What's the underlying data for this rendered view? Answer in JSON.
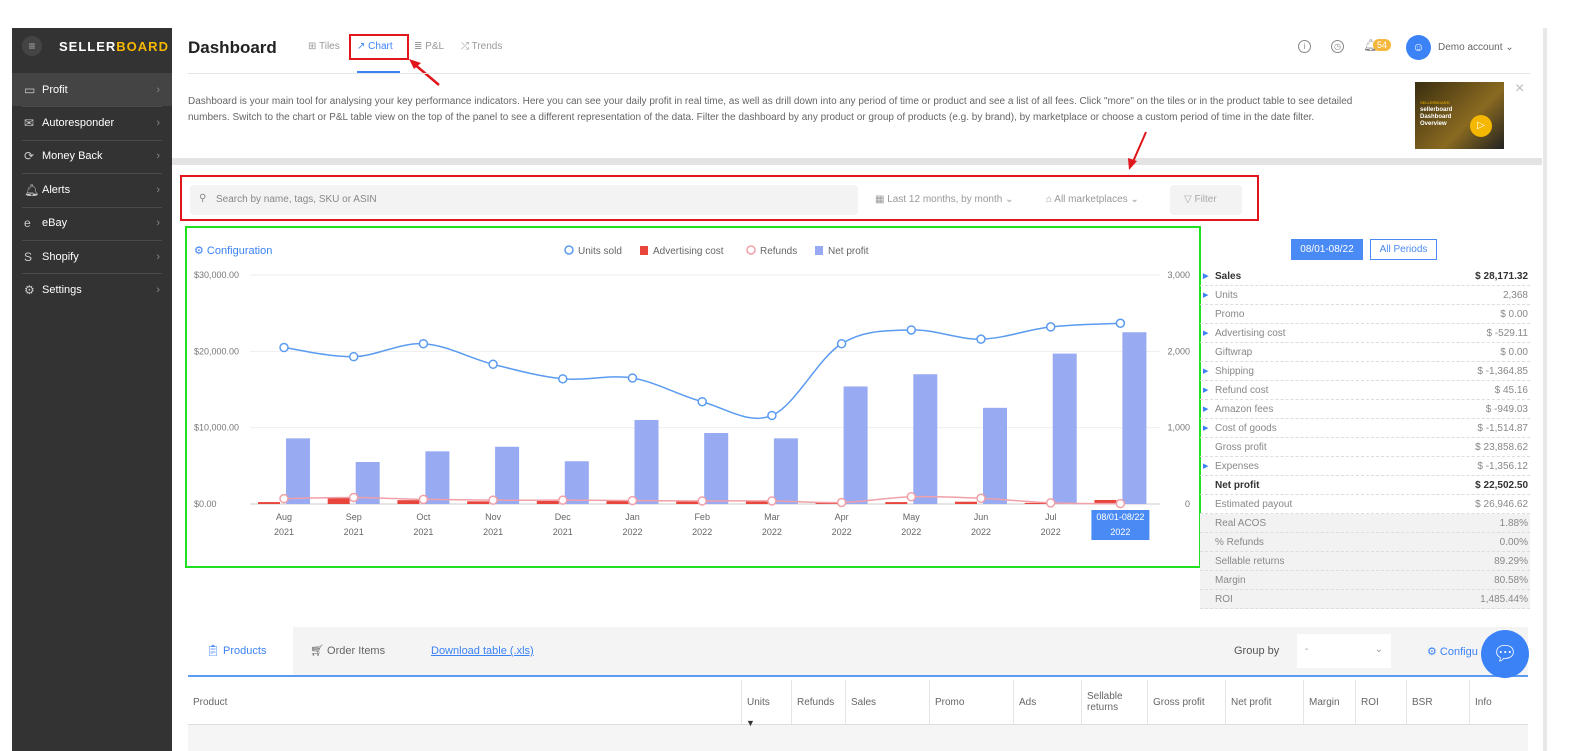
{
  "sidebar": {
    "brand_a": "SELLER",
    "brand_b": "BOARD",
    "items": [
      {
        "label": "Profit",
        "icon": "monitor-icon"
      },
      {
        "label": "Autoresponder",
        "icon": "envelope-icon"
      },
      {
        "label": "Money Back",
        "icon": "refresh-icon"
      },
      {
        "label": "Alerts",
        "icon": "bell-icon"
      },
      {
        "label": "eBay",
        "icon": "ebay-icon"
      },
      {
        "label": "Shopify",
        "icon": "shopify-icon"
      },
      {
        "label": "Settings",
        "icon": "gear-icon"
      }
    ]
  },
  "header": {
    "title": "Dashboard",
    "tabs": [
      "Tiles",
      "Chart",
      "P&L",
      "Trends"
    ],
    "active_tab": "Chart",
    "notifications": "54",
    "account": "Demo account"
  },
  "description": "Dashboard is your main tool for analysing your key performance indicators. Here you can see your daily profit in real time, as well as drill down into any period of time or product and see a list of all fees. Click \"more\" on the tiles or in the product table to see detailed numbers. Switch to the chart or P&L table view on the top of the panel to see a different representation of the data. Filter the dashboard by any product or group of products (e.g. by brand), by marketplace or choose a custom period of time in the date filter.",
  "video": {
    "brand": "SELLERBOARD",
    "title": "sellerboard Dashboard Overview"
  },
  "filters": {
    "search_placeholder": "Search by name, tags, SKU or ASIN",
    "period": "Last 12 months, by month",
    "marketplace": "All marketplaces",
    "filter": "Filter"
  },
  "chart_config_label": "Configuration",
  "colors": {
    "accent": "#3b82f6",
    "units": "#5b9bf0",
    "ads": "#e8453c",
    "refunds": "#f0a0a8",
    "net_profit": "#97aaf2"
  },
  "chart_data": {
    "type": "bar",
    "categories": [
      [
        "Aug",
        "2021"
      ],
      [
        "Sep",
        "2021"
      ],
      [
        "Oct",
        "2021"
      ],
      [
        "Nov",
        "2021"
      ],
      [
        "Dec",
        "2021"
      ],
      [
        "Jan",
        "2022"
      ],
      [
        "Feb",
        "2022"
      ],
      [
        "Mar",
        "2022"
      ],
      [
        "Apr",
        "2022"
      ],
      [
        "May",
        "2022"
      ],
      [
        "Jun",
        "2022"
      ],
      [
        "Jul",
        "2022"
      ],
      [
        "08/01-08/22",
        "2022"
      ]
    ],
    "y_left": {
      "ticks": [
        "$0.00",
        "$10,000.00",
        "$20,000.00",
        "$30,000.00"
      ],
      "range": [
        0,
        30000
      ]
    },
    "y_right": {
      "ticks": [
        "0",
        "1,000",
        "2,000",
        "3,000"
      ],
      "range": [
        0,
        3000
      ]
    },
    "legend": [
      "Units sold",
      "Advertising cost",
      "Refunds",
      "Net profit"
    ],
    "legend_position": "top",
    "grid": true,
    "series": [
      {
        "name": "Units sold",
        "type": "line",
        "axis": "right",
        "values": [
          2050,
          1930,
          2100,
          1830,
          1640,
          1650,
          1340,
          1160,
          2100,
          2280,
          2160,
          2320,
          2368
        ]
      },
      {
        "name": "Advertising cost",
        "type": "bar",
        "axis": "left",
        "values": [
          250,
          800,
          500,
          350,
          400,
          400,
          450,
          450,
          250,
          250,
          300,
          150,
          529
        ]
      },
      {
        "name": "Refunds",
        "type": "line",
        "axis": "right",
        "values": [
          70,
          85,
          60,
          50,
          50,
          45,
          40,
          40,
          20,
          95,
          75,
          15,
          5
        ]
      },
      {
        "name": "Net profit",
        "type": "bar",
        "axis": "left",
        "values": [
          8600,
          5500,
          6900,
          7500,
          5600,
          11000,
          9300,
          8600,
          15400,
          17000,
          12600,
          19700,
          22500
        ]
      }
    ]
  },
  "summary": {
    "period_button": "08/01-08/22",
    "all_button": "All Periods",
    "rows": [
      {
        "label": "Sales",
        "value": "$ 28,171.32",
        "bold": true,
        "expand": true
      },
      {
        "label": "Units",
        "value": "2,368",
        "expand": true
      },
      {
        "label": "Promo",
        "value": "$ 0.00"
      },
      {
        "label": "Advertising cost",
        "value": "$ -529.11",
        "expand": true
      },
      {
        "label": "Giftwrap",
        "value": "$ 0.00"
      },
      {
        "label": "Shipping",
        "value": "$ -1,364.85",
        "expand": true
      },
      {
        "label": "Refund cost",
        "value": "$ 45.16",
        "expand": true
      },
      {
        "label": "Amazon fees",
        "value": "$ -949.03",
        "expand": true
      },
      {
        "label": "Cost of goods",
        "value": "$ -1,514.87",
        "expand": true
      },
      {
        "label": "Gross profit",
        "value": "$ 23,858.62"
      },
      {
        "label": "Expenses",
        "value": "$ -1,356.12",
        "expand": true
      },
      {
        "label": "Net profit",
        "value": "$ 22,502.50",
        "bold": true
      },
      {
        "label": "Estimated payout",
        "value": "$ 26,946.62"
      },
      {
        "label": "Real ACOS",
        "value": "1.88%",
        "grey": true
      },
      {
        "label": "% Refunds",
        "value": "0.00%",
        "grey": true
      },
      {
        "label": "Sellable returns",
        "value": "89.29%",
        "grey": true
      },
      {
        "label": "Margin",
        "value": "80.58%",
        "grey": true
      },
      {
        "label": "ROI",
        "value": "1,485.44%",
        "grey": true
      }
    ]
  },
  "products": {
    "tabs": [
      "Products",
      "Order Items"
    ],
    "download": "Download table (.xls)",
    "group_by": "Group by",
    "group_value": "-",
    "config": "Configu",
    "columns": [
      "Product",
      "Units",
      "Refunds",
      "Sales",
      "Promo",
      "Ads",
      "Sellable returns",
      "Gross profit",
      "Net profit",
      "Margin",
      "ROI",
      "BSR",
      "Info"
    ]
  }
}
